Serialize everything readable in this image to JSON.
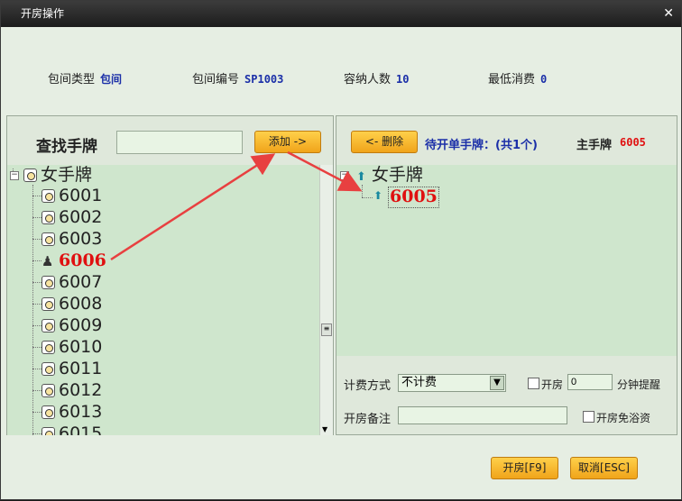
{
  "window": {
    "title": "开房操作",
    "close_glyph": "✕"
  },
  "info": {
    "room_type_label": "包间类型",
    "room_type_value": "包间",
    "room_no_label": "包间编号",
    "room_no_value": "SP1003",
    "capacity_label": "容纳人数",
    "capacity_value": "10",
    "min_spend_label": "最低消费",
    "min_spend_value": "0"
  },
  "left": {
    "search_label": "查找手牌",
    "search_value": "",
    "add_button": "添加 ->",
    "tree_root": "女手牌",
    "items": [
      "6001",
      "6002",
      "6003",
      "6006",
      "6007",
      "6008",
      "6009",
      "6010",
      "6011",
      "6012",
      "6013",
      "6015"
    ],
    "highlighted_item": "6006"
  },
  "right": {
    "delete_button": "<- 删除",
    "pending_label": "待开单手牌：(共1个)",
    "main_tag_label": "主手牌",
    "main_tag_value": "6005",
    "tree_root": "女手牌",
    "tree_child": "6005",
    "billing_label": "计费方式",
    "billing_value": "不计费",
    "open_room_label": "开房",
    "minutes_value": "0",
    "reminder_label": "分钟提醒",
    "remark_label": "开房备注",
    "remark_value": "",
    "free_bath_label": "开房免浴资"
  },
  "footer": {
    "open_button": "开房[F9]",
    "cancel_button": "取消[ESC]"
  },
  "colors": {
    "accent_red": "#e01010",
    "accent_blue": "#1b2fa8",
    "button_orange": "#f5b22a"
  }
}
